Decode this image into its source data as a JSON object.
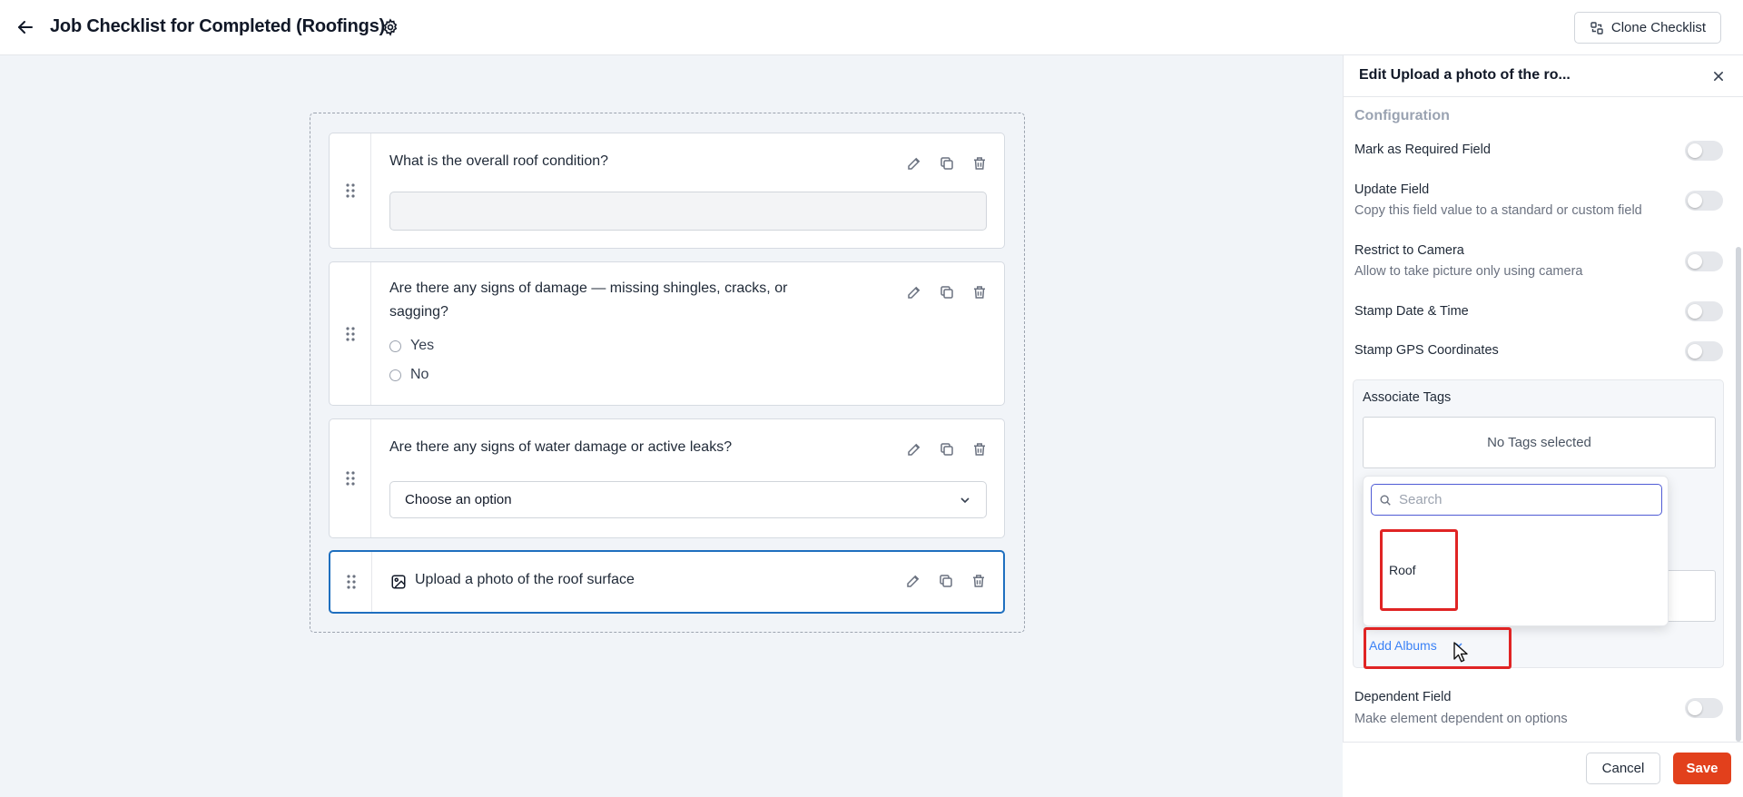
{
  "header": {
    "title": "Job Checklist for Completed (Roofings)",
    "clone_label": "Clone Checklist",
    "back_icon": "arrow-left-icon",
    "settings_icon": "gear-icon",
    "clone_icon": "clone-icon"
  },
  "questions": [
    {
      "text": "What is the overall roof condition?",
      "type": "text"
    },
    {
      "text": "Are there any signs of damage — missing shingles, cracks, or sagging?",
      "type": "radio",
      "options": [
        "Yes",
        "No"
      ]
    },
    {
      "text": "Are there any signs of water damage or active leaks?",
      "type": "select",
      "placeholder": "Choose an option"
    },
    {
      "text": "Upload a photo of the roof surface",
      "type": "photo",
      "selected": true
    }
  ],
  "panel": {
    "title": "Edit Upload a photo of the ro...",
    "section": "Configuration",
    "options": [
      {
        "label": "Mark as Required Field",
        "sub": "",
        "on": false
      },
      {
        "label": "Update Field",
        "sub": "Copy this field value to a standard or custom field",
        "on": false
      },
      {
        "label": "Restrict to Camera",
        "sub": "Allow to take picture only using camera",
        "on": false
      },
      {
        "label": "Stamp Date & Time",
        "sub": "",
        "on": false
      },
      {
        "label": "Stamp GPS Coordinates",
        "sub": "",
        "on": false
      }
    ],
    "tags": {
      "label": "Associate Tags",
      "empty": "No Tags selected"
    },
    "dropdown": {
      "search_placeholder": "Search",
      "items": [
        "Roof"
      ]
    },
    "add_albums": "Add Albums",
    "dependent": {
      "label": "Dependent Field",
      "sub": "Make element dependent on options",
      "on": false
    },
    "cancel": "Cancel",
    "save": "Save"
  },
  "colors": {
    "accent": "#1f6fbf",
    "save": "#e2401c",
    "highlight": "#e02424",
    "link": "#3b82f6"
  }
}
